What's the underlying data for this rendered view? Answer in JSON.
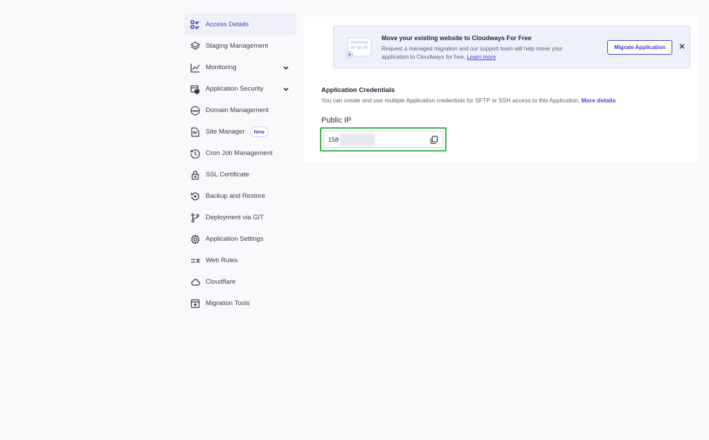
{
  "sidebar": {
    "items": [
      {
        "label": "Access Details",
        "icon": "access-details-icon",
        "active": true
      },
      {
        "label": "Staging Management",
        "icon": "layers-icon"
      },
      {
        "label": "Monitoring",
        "icon": "chart-line-icon",
        "expandable": true
      },
      {
        "label": "Application Security",
        "icon": "shield-window-icon",
        "expandable": true
      },
      {
        "label": "Domain Management",
        "icon": "www-globe-icon"
      },
      {
        "label": "Site Manager",
        "icon": "site-manager-icon",
        "badge": "New"
      },
      {
        "label": "Cron Job Management",
        "icon": "clock-history-icon"
      },
      {
        "label": "SSL Certificate",
        "icon": "lock-icon"
      },
      {
        "label": "Backup and Restore",
        "icon": "backup-restore-icon"
      },
      {
        "label": "Deployment via GIT",
        "icon": "git-branch-icon"
      },
      {
        "label": "Application Settings",
        "icon": "gear-icon"
      },
      {
        "label": "Web Rules",
        "icon": "web-rules-icon"
      },
      {
        "label": "Cloudflare",
        "icon": "cloud-icon"
      },
      {
        "label": "Migration Tools",
        "icon": "migration-icon"
      }
    ]
  },
  "banner": {
    "title": "Move your existing website to Cloudways For Free",
    "description": "Request a managed migration and our support team will help move your application to Cloudways for free.",
    "link": "Learn more",
    "button": "Migrate Application"
  },
  "credentials": {
    "title": "Application Credentials",
    "description": "You can create and use multiple Application credentials for SFTP or SSH access to this Application.",
    "more_link": "More details"
  },
  "public_ip": {
    "label": "Public IP",
    "value": "158"
  },
  "colors": {
    "accent": "#3f45c9",
    "highlight": "#3eb24c",
    "background": "#f9f9fc"
  }
}
